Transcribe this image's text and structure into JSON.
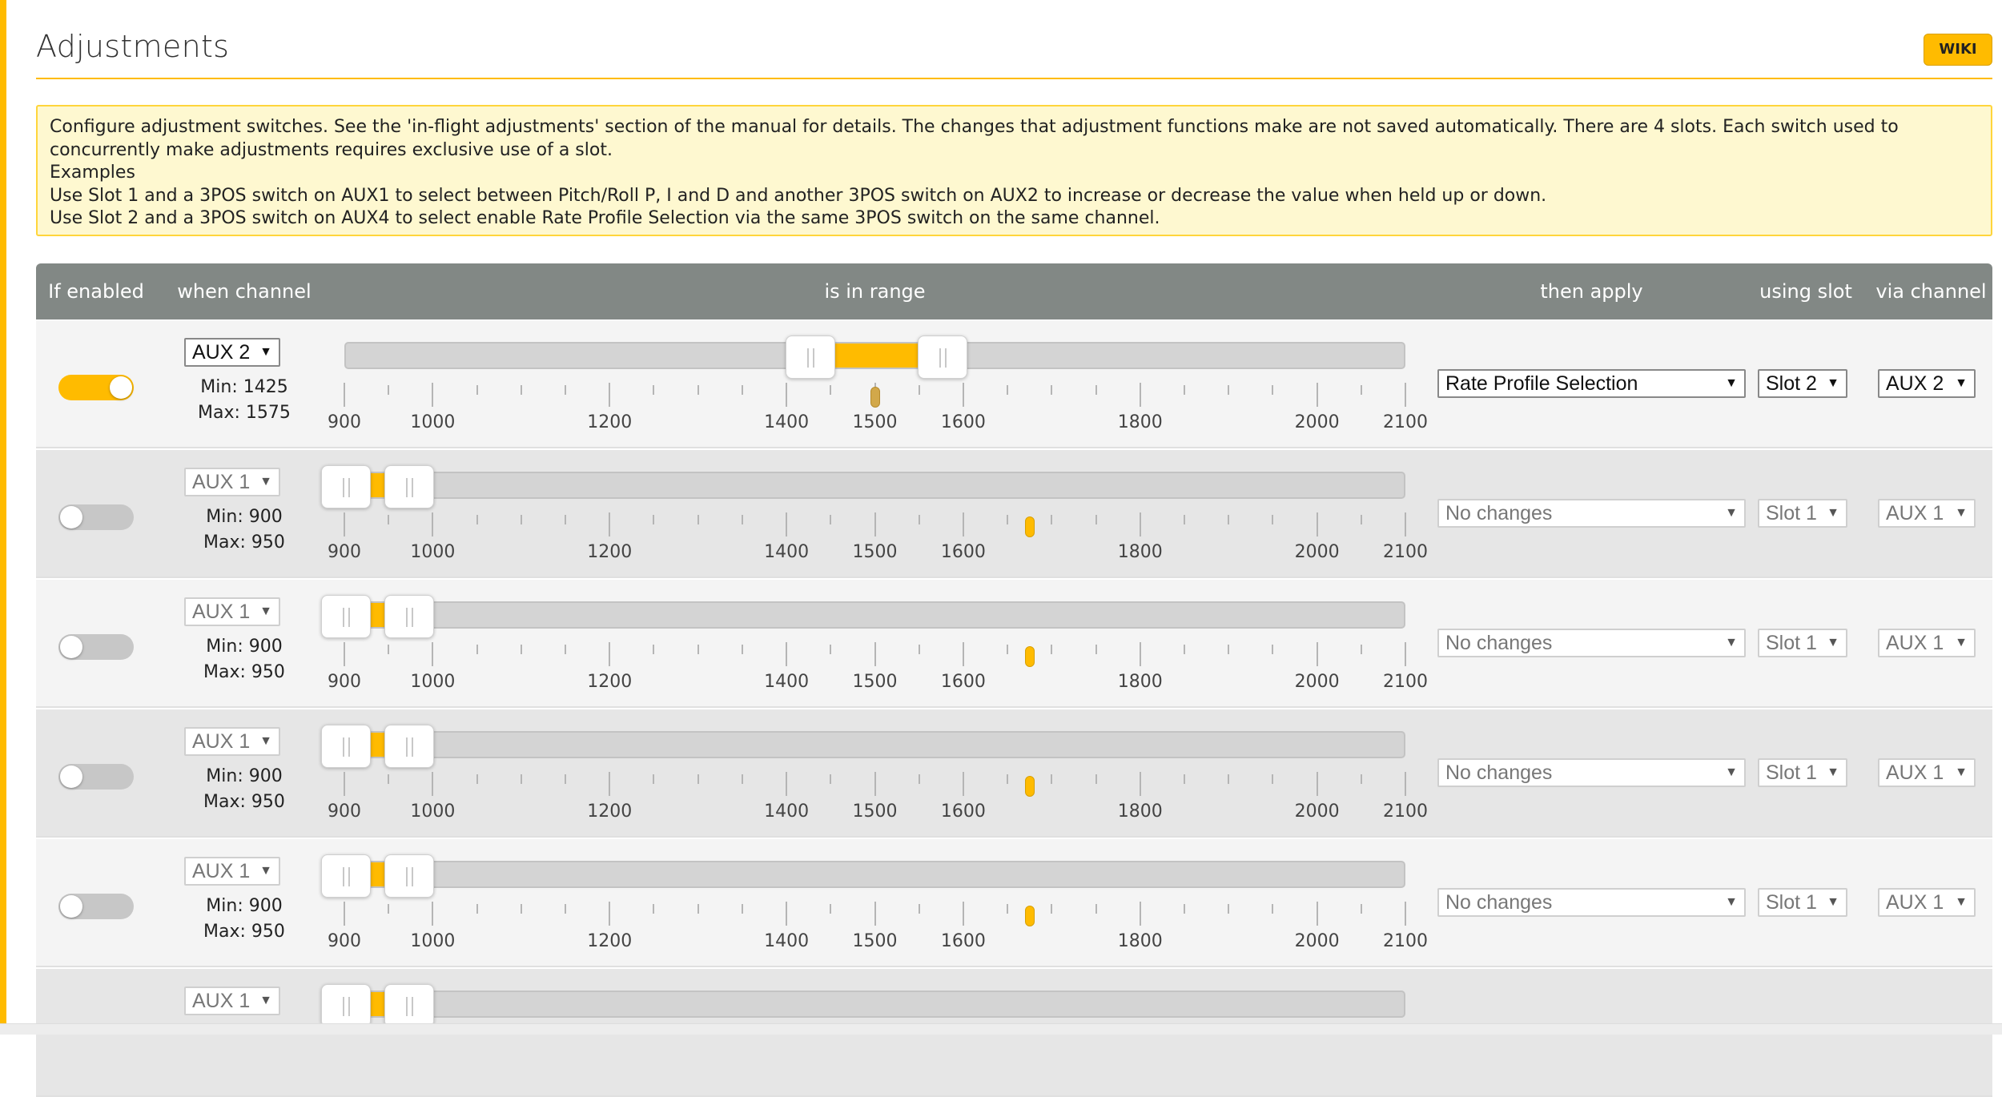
{
  "page": {
    "title": "Adjustments",
    "wiki_label": "WIKI",
    "accent_color": "#ffbb00"
  },
  "note": {
    "lines": [
      "Configure adjustment switches. See the 'in-flight adjustments' section of the manual for details. The changes that adjustment functions make are not saved automatically. There are 4 slots. Each switch used to concurrently make adjustments requires exclusive use of a slot.",
      "Examples",
      "Use Slot 1 and a 3POS switch on AUX1 to select between Pitch/Roll P, I and D and another 3POS switch on AUX2 to increase or decrease the value when held up or down.",
      "Use Slot 2 and a 3POS switch on AUX4 to select enable Rate Profile Selection via the same 3POS switch on the same channel."
    ]
  },
  "table": {
    "headers": {
      "enabled": "If enabled",
      "channel": "when channel",
      "range": "is in range",
      "apply": "then apply",
      "slot": "using slot",
      "via": "via channel"
    },
    "scale": {
      "min": 900,
      "max": 2100,
      "labels": [
        "900",
        "1000",
        "1200",
        "1400",
        "1500",
        "1600",
        "1800",
        "2000",
        "2100"
      ],
      "label_values": [
        900,
        1000,
        1200,
        1400,
        1500,
        1600,
        1800,
        2000,
        2100
      ]
    },
    "min_prefix": "Min: ",
    "max_prefix": "Max: ",
    "rows": [
      {
        "enabled": true,
        "channel": "AUX 2",
        "min_text": "Min: 1425",
        "max_text": "Max: 1575",
        "range_min": 1425,
        "range_max": 1575,
        "marker": 1500,
        "apply": "Rate Profile Selection",
        "slot": "Slot 2",
        "via": "AUX 2"
      },
      {
        "enabled": false,
        "channel": "AUX 1",
        "min_text": "Min: 900",
        "max_text": "Max: 950",
        "range_min": 900,
        "range_max": 950,
        "marker": 1675,
        "apply": "No changes",
        "slot": "Slot 1",
        "via": "AUX 1"
      },
      {
        "enabled": false,
        "channel": "AUX 1",
        "min_text": "Min: 900",
        "max_text": "Max: 950",
        "range_min": 900,
        "range_max": 950,
        "marker": 1675,
        "apply": "No changes",
        "slot": "Slot 1",
        "via": "AUX 1"
      },
      {
        "enabled": false,
        "channel": "AUX 1",
        "min_text": "Min: 900",
        "max_text": "Max: 950",
        "range_min": 900,
        "range_max": 950,
        "marker": 1675,
        "apply": "No changes",
        "slot": "Slot 1",
        "via": "AUX 1"
      },
      {
        "enabled": false,
        "channel": "AUX 1",
        "min_text": "Min: 900",
        "max_text": "Max: 950",
        "range_min": 900,
        "range_max": 950,
        "marker": 1675,
        "apply": "No changes",
        "slot": "Slot 1",
        "via": "AUX 1"
      },
      {
        "enabled": false,
        "channel": "AUX 1",
        "range_min": 900,
        "range_max": 950,
        "partial": true
      }
    ]
  }
}
